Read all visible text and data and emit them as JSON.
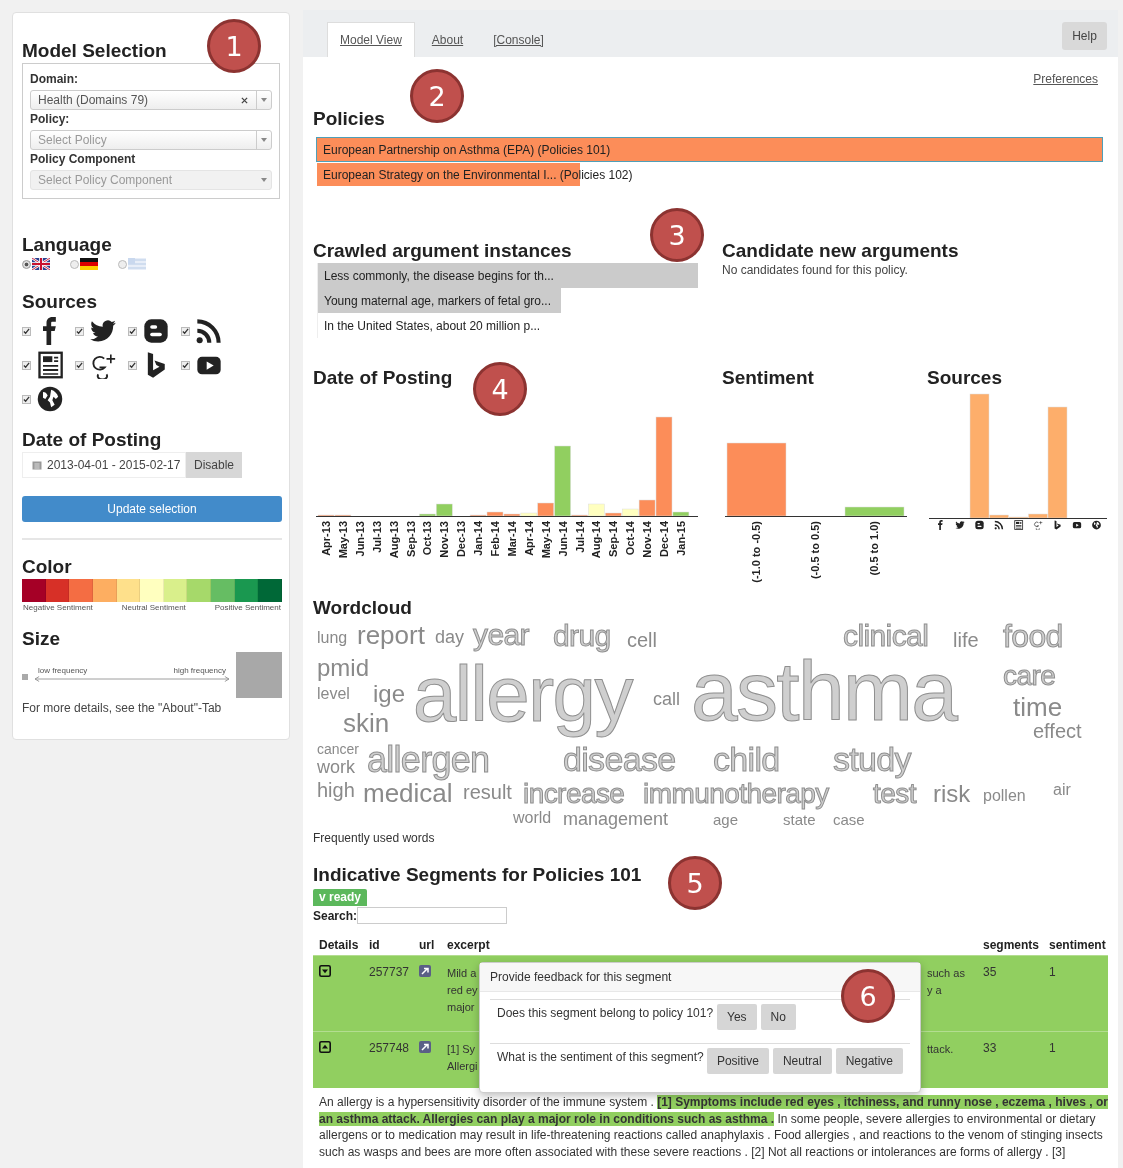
{
  "markers": [
    "1",
    "2",
    "3",
    "4",
    "5",
    "6"
  ],
  "sidebar": {
    "model_selection": {
      "title": "Model Selection",
      "fields": [
        {
          "label": "Domain:",
          "value": "Health (Domains 79)",
          "clearable": true,
          "disabled": false
        },
        {
          "label": "Policy:",
          "placeholder": "Select Policy",
          "clearable": false,
          "disabled": false
        },
        {
          "label": "Policy Component",
          "placeholder": "Select Policy Component",
          "clearable": false,
          "disabled": true
        }
      ]
    },
    "language": {
      "title": "Language",
      "options": [
        {
          "kind": "uk",
          "selected": true
        },
        {
          "kind": "de",
          "selected": false
        },
        {
          "kind": "gr",
          "selected": false
        }
      ]
    },
    "sources": {
      "title": "Sources",
      "items": [
        {
          "kind": "facebook",
          "checked": true
        },
        {
          "kind": "twitter",
          "checked": true
        },
        {
          "kind": "blogger",
          "checked": true
        },
        {
          "kind": "rss",
          "checked": true
        },
        {
          "kind": "news",
          "checked": true
        },
        {
          "kind": "gplus",
          "checked": true
        },
        {
          "kind": "bing",
          "checked": true
        },
        {
          "kind": "youtube",
          "checked": true
        },
        {
          "kind": "web",
          "checked": true
        }
      ]
    },
    "date": {
      "title": "Date of Posting",
      "range": "2013-04-01 - 2015-02-17",
      "button": "Disable"
    },
    "update_button": "Update selection",
    "color": {
      "title": "Color",
      "swatches": [
        {
          "color": "#a50026"
        },
        {
          "color": "#d73027"
        },
        {
          "color": "#f46d43"
        },
        {
          "color": "#fdae61"
        },
        {
          "color": "#fee08b"
        },
        {
          "color": "#ffffbf"
        },
        {
          "color": "#d9ef8b"
        },
        {
          "color": "#a6d96a"
        },
        {
          "color": "#66bd63"
        },
        {
          "color": "#1a9850"
        },
        {
          "color": "#006837"
        }
      ],
      "labels": [
        "Negative Sentiment",
        "Neutral Sentiment",
        "Positive Sentiment"
      ]
    },
    "size": {
      "title": "Size",
      "low": "low frequency",
      "high": "high frequency"
    },
    "note": "For more details, see the \"About\"-Tab"
  },
  "tabs": [
    {
      "label": "Model View",
      "selected": true
    },
    {
      "label": "About",
      "selected": false
    },
    {
      "label": "[Console]",
      "selected": false
    }
  ],
  "help_button": "Help",
  "preferences_link": "Preferences",
  "policies": {
    "title": "Policies",
    "items": [
      {
        "label": "European Partnership on Asthma (EPA) (Policies 101)",
        "level": 1,
        "selected": true
      },
      {
        "label": "European Strategy on the Environmental I... (Policies 102)",
        "level": 0.335,
        "selected": false
      }
    ]
  },
  "crawled": {
    "title": "Crawled argument instances",
    "items": [
      {
        "text": "Less commonly, the disease begins for th...",
        "level": 1
      },
      {
        "text": "Young maternal age, markers of fetal gro...",
        "level": 0.64
      },
      {
        "text": "In the United States, about 20 million p..."
      }
    ]
  },
  "candidates": {
    "title": "Candidate new arguments",
    "message": "No candidates found for this policy."
  },
  "charts": {
    "date": {
      "title": "Date of Posting",
      "labels": [
        "Apr-13",
        "May-13",
        "Jun-13",
        "Jul-13",
        "Aug-13",
        "Sep-13",
        "Oct-13",
        "Nov-13",
        "Dec-13",
        "Jan-14",
        "Feb-14",
        "Mar-14",
        "Apr-14",
        "May-14",
        "Jun-14",
        "Jul-14",
        "Aug-14",
        "Sep-14",
        "Oct-14",
        "Nov-14",
        "Dec-14",
        "Jan-15"
      ]
    },
    "sentiment": {
      "title": "Sentiment",
      "labels": [
        "(-1.0 to -0.5)",
        "(-0.5 to 0.5)",
        "(0.5 to 1.0)"
      ]
    },
    "sources": {
      "title": "Sources",
      "icons": [
        {
          "kind": "facebook"
        },
        {
          "kind": "twitter"
        },
        {
          "kind": "blogger"
        },
        {
          "kind": "rss"
        },
        {
          "kind": "news"
        },
        {
          "kind": "gplus"
        },
        {
          "kind": "bing"
        },
        {
          "kind": "youtube"
        },
        {
          "kind": "web"
        }
      ]
    }
  },
  "wordcloud": {
    "title": "Wordcloud",
    "words": [
      "lung",
      "report",
      "day",
      "year",
      "drug",
      "cell",
      "clinical",
      "life",
      "food",
      "pmid",
      "level",
      "ige",
      "skin",
      "allergy",
      "call",
      "asthma",
      "care",
      "time",
      "effect",
      "cancer",
      "work",
      "allergen",
      "disease",
      "child",
      "study",
      "high",
      "medical",
      "result",
      "increase",
      "immunotherapy",
      "test",
      "risk",
      "pollen",
      "air",
      "world",
      "management",
      "age",
      "state",
      "case"
    ],
    "caption": "Frequently used words"
  },
  "segments": {
    "title": "Indicative Segments for Policies 101",
    "status": "v ready",
    "search_label": "Search:",
    "columns": [
      "Details",
      "id",
      "url",
      "excerpt",
      "segments",
      "sentiment"
    ],
    "rows": [
      {
        "id": "257737",
        "expanded": false,
        "excerpt_start": [
          "Mild a",
          "red ey",
          "major"
        ],
        "excerpt_end": [
          "such as",
          "y a"
        ],
        "segments": "35",
        "sentiment": "1"
      },
      {
        "id": "257748",
        "expanded": true,
        "excerpt_start": [
          "[1] Sy",
          "Allergi"
        ],
        "excerpt_end": [
          "ttack."
        ],
        "segments": "33",
        "sentiment": "1"
      }
    ],
    "details": "An allergy is a hypersensitivity disorder of the immune system . **[1] Symptoms include red eyes , itchiness, and runny nose , eczema , hives , or an asthma attack. Allergies can play a major role in conditions such as asthma .** In some people, severe allergies to environmental or dietary allergens or to medication may result in life-threatening reactions called anaphylaxis . Food allergies , and reactions to the venom of stinging insects such as wasps and bees are more often associated with these severe reactions . [2] Not all reactions or intolerances are forms of allergy . [3]"
  },
  "feedback_popup": {
    "title": "Provide feedback for this segment",
    "questions": [
      {
        "text": "Does this segment belong to policy 101?",
        "options": [
          "Yes",
          "No"
        ]
      },
      {
        "text": "What is the sentiment of this segment?",
        "options": [
          "Positive",
          "Neutral",
          "Negative"
        ]
      }
    ]
  }
}
